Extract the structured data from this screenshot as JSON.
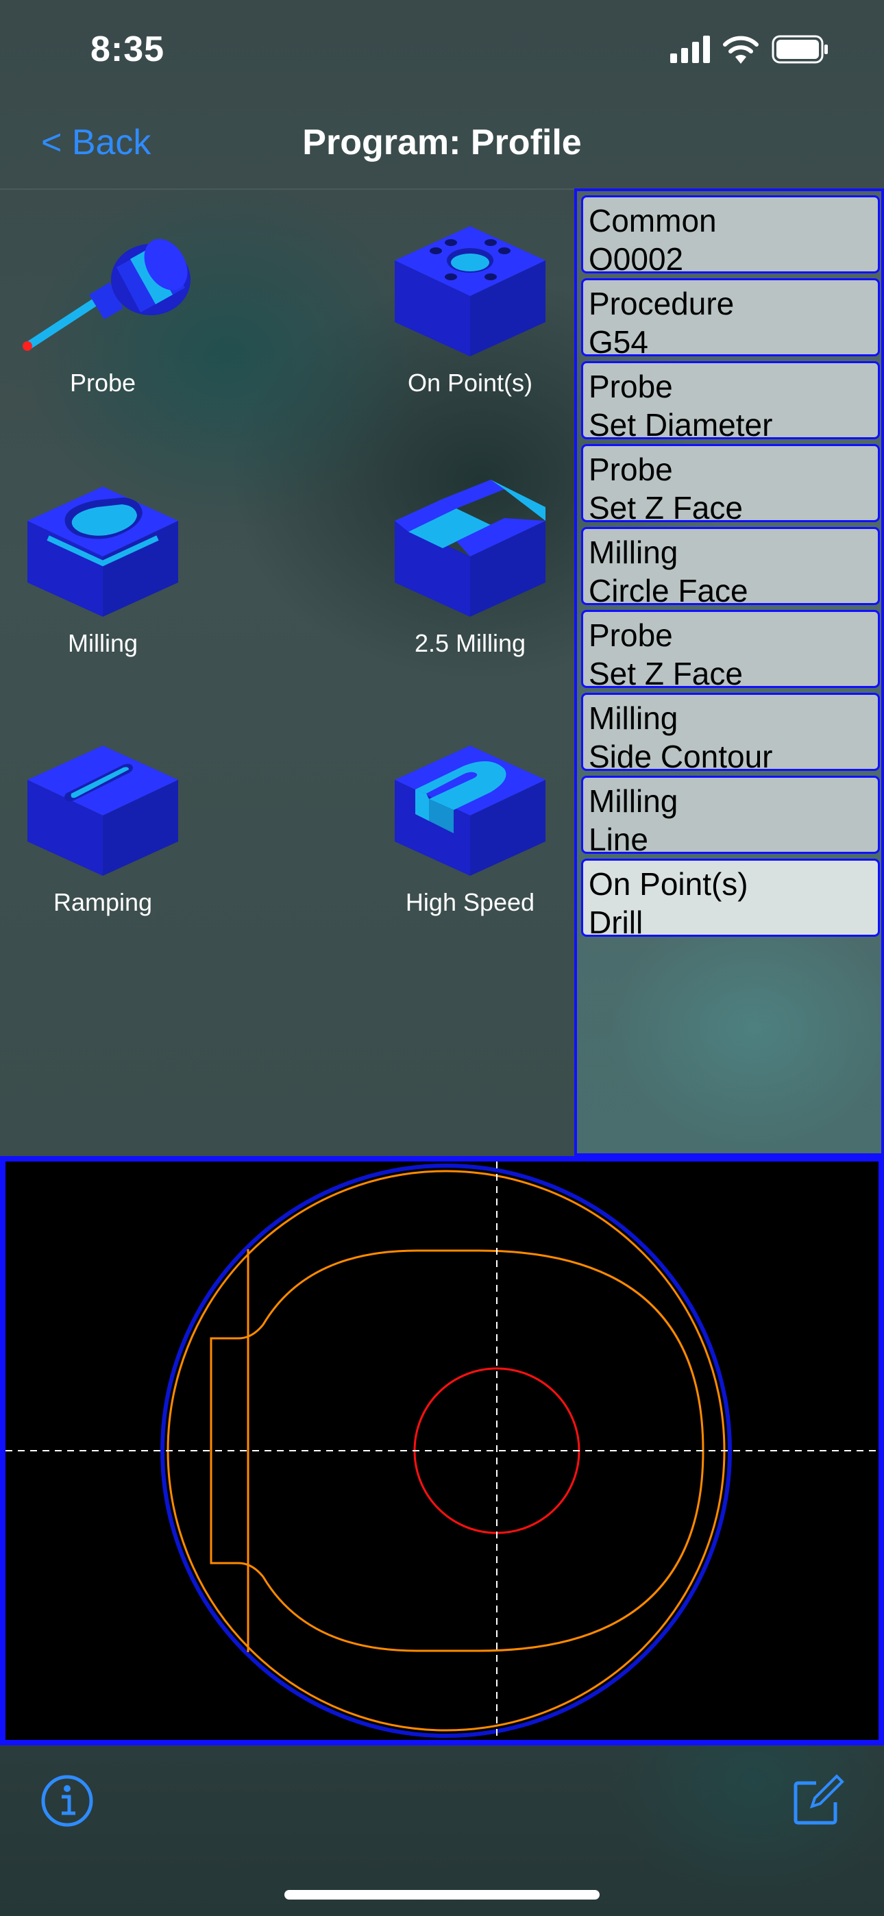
{
  "status_bar": {
    "time": "8:35",
    "icons": [
      "signal-icon",
      "wifi-icon",
      "battery-icon"
    ]
  },
  "nav": {
    "back_label": "< Back",
    "title": "Program: Profile"
  },
  "tools": [
    {
      "label": "Probe",
      "icon": "probe-icon"
    },
    {
      "label": "On Point(s)",
      "icon": "on-points-icon"
    },
    {
      "label": "Milling",
      "icon": "milling-icon"
    },
    {
      "label": "2.5 Milling",
      "icon": "milling-2-5-icon"
    },
    {
      "label": "Ramping",
      "icon": "ramping-icon"
    },
    {
      "label": "High Speed",
      "icon": "high-speed-icon"
    }
  ],
  "procedures": [
    {
      "category": "Common",
      "name": "O0002"
    },
    {
      "category": "Procedure",
      "name": "G54"
    },
    {
      "category": "Probe",
      "name": "Set Diameter"
    },
    {
      "category": "Probe",
      "name": "Set Z Face"
    },
    {
      "category": "Milling",
      "name": "Circle Face"
    },
    {
      "category": "Probe",
      "name": "Set Z Face"
    },
    {
      "category": "Milling",
      "name": "Side Contour"
    },
    {
      "category": "Milling",
      "name": "Line"
    },
    {
      "category": "On Point(s)",
      "name": "Drill"
    }
  ],
  "selected_procedure_index": 8,
  "toolbar": {
    "info_icon": "info-icon",
    "edit_icon": "compose-icon"
  },
  "colors": {
    "accent": "#2f8cff",
    "panel_border": "#1010ff",
    "part_blue": "#2233ee",
    "part_cyan": "#19b4f0",
    "toolpath_orange": "#ff8a00",
    "stock_outline": "#0a14d0",
    "hole_red": "#ff1010",
    "crosshair": "#ffffff"
  }
}
